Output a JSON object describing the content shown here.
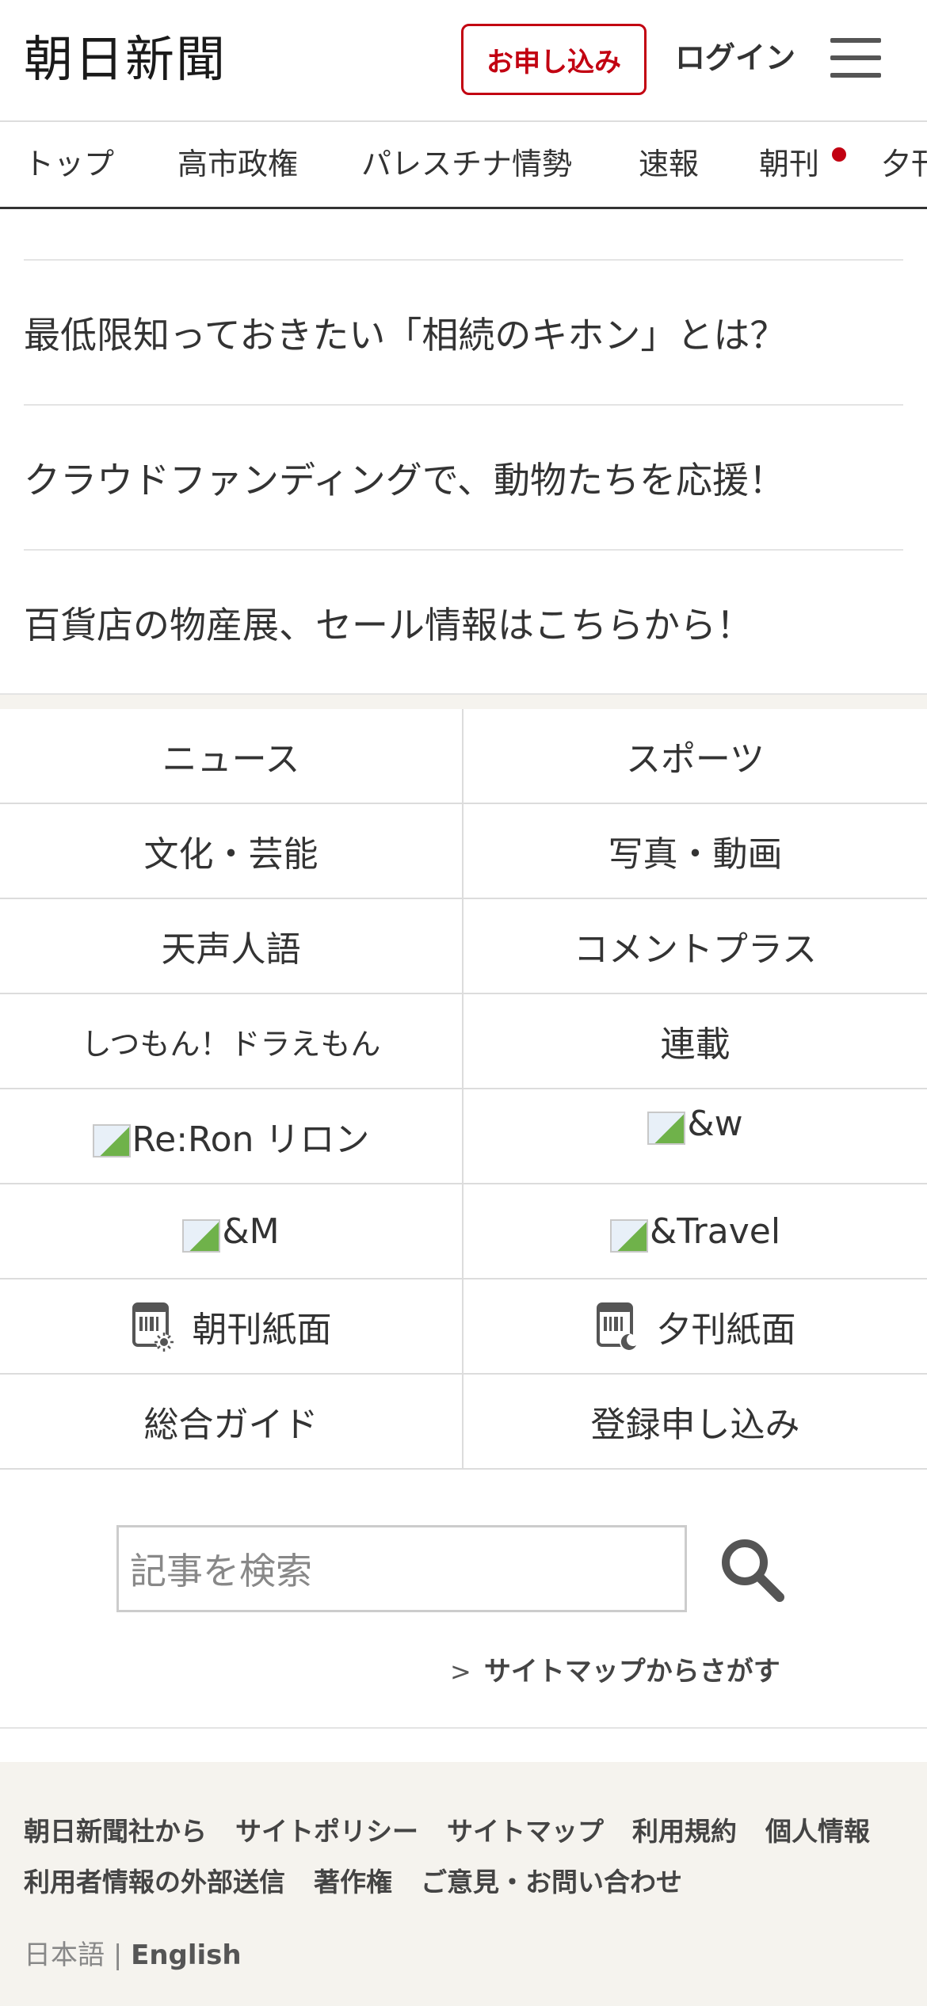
{
  "header": {
    "logo": "朝日新聞",
    "apply_label": "お申し込み",
    "login_label": "ログイン",
    "menu_icon": "hamburger-menu-icon",
    "accent_color": "#c20011"
  },
  "nav": {
    "items": [
      "トップ",
      "高市政権",
      "パレスチナ情勢",
      "速報",
      "朝刊",
      "夕刊"
    ]
  },
  "promos": [
    "最低限知っておきたい「相続のキホン」とは？",
    "クラウドファンディングで、動物たちを応援！",
    "百貨店の物産展、セール情報はこちらから！"
  ],
  "grid": {
    "news": "ニュース",
    "sports": "スポーツ",
    "culture": "文化・芸能",
    "photo_video": "写真・動画",
    "tenseijingo": "天声人語",
    "comment_plus": "コメントプラス",
    "doraemon": "しつもん！ドラえもん",
    "series": "連載",
    "reron": "Re:Ron リロン",
    "and_w": "&w",
    "and_m": "&M",
    "and_travel": "&Travel",
    "morning_paper": "朝刊紙面",
    "evening_paper": "夕刊紙面",
    "guide": "総合ガイド",
    "register": "登録申し込み"
  },
  "search": {
    "placeholder": "記事を検索",
    "sitemap_label": "サイトマップからさがす"
  },
  "footer": {
    "links": [
      "朝日新聞社から",
      "サイトポリシー",
      "サイトマップ",
      "利用規約",
      "個人情報",
      "利用者情報の外部送信",
      "著作権",
      "ご意見・お問い合わせ"
    ],
    "lang_ja": "日本語",
    "lang_sep": "|",
    "lang_en": "English"
  }
}
